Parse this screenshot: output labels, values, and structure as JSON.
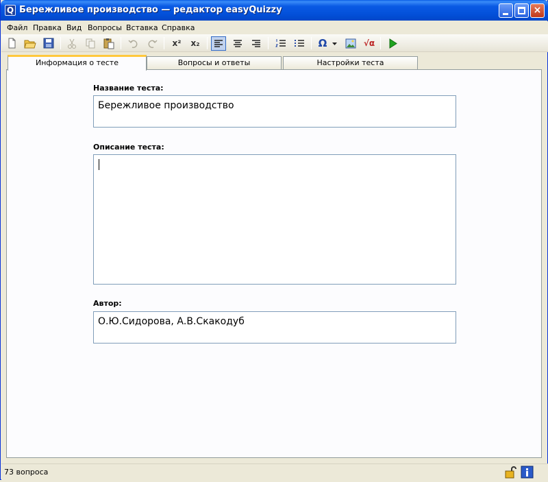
{
  "window": {
    "app_icon": "Q",
    "title": "Бережливое производство — редактор easyQuizzy",
    "controls": {
      "minimize": "minimize-icon",
      "maximize": "maximize-icon",
      "close": "×"
    }
  },
  "menu": [
    "Файл",
    "Правка",
    "Вид",
    "Вопросы",
    "Вставка",
    "Справка"
  ],
  "toolbar": {
    "superscript": "x²",
    "subscript": "x₂",
    "omega": "Ω",
    "formula": "√α",
    "icons": [
      "new-document-icon",
      "open-folder-icon",
      "save-icon",
      "cut-icon",
      "copy-icon",
      "paste-icon",
      "undo-icon",
      "redo-icon",
      "superscript-icon",
      "subscript-icon",
      "align-left-icon",
      "align-center-icon",
      "align-right-icon",
      "numbered-list-icon",
      "bullet-list-icon",
      "special-char-icon",
      "dropdown-icon",
      "insert-image-icon",
      "insert-formula-icon",
      "run-test-icon"
    ]
  },
  "tabs": [
    {
      "label": "Информация о тесте",
      "selected": true
    },
    {
      "label": "Вопросы и ответы",
      "selected": false
    },
    {
      "label": "Настройки теста",
      "selected": false
    }
  ],
  "form": {
    "title_label": "Название теста:",
    "title_value": "Бережливое производство",
    "description_label": "Описание теста:",
    "description_value": "",
    "author_label": "Автор:",
    "author_value": "О.Ю.Сидорова, А.В.Скакодуб"
  },
  "status": {
    "text": "73 вопроса",
    "icons": [
      "unlocked-icon",
      "info-icon"
    ]
  },
  "colors": {
    "titlebar": "#0350d9",
    "accent_tab": "#ffc83c",
    "run": "#1fa31f"
  }
}
